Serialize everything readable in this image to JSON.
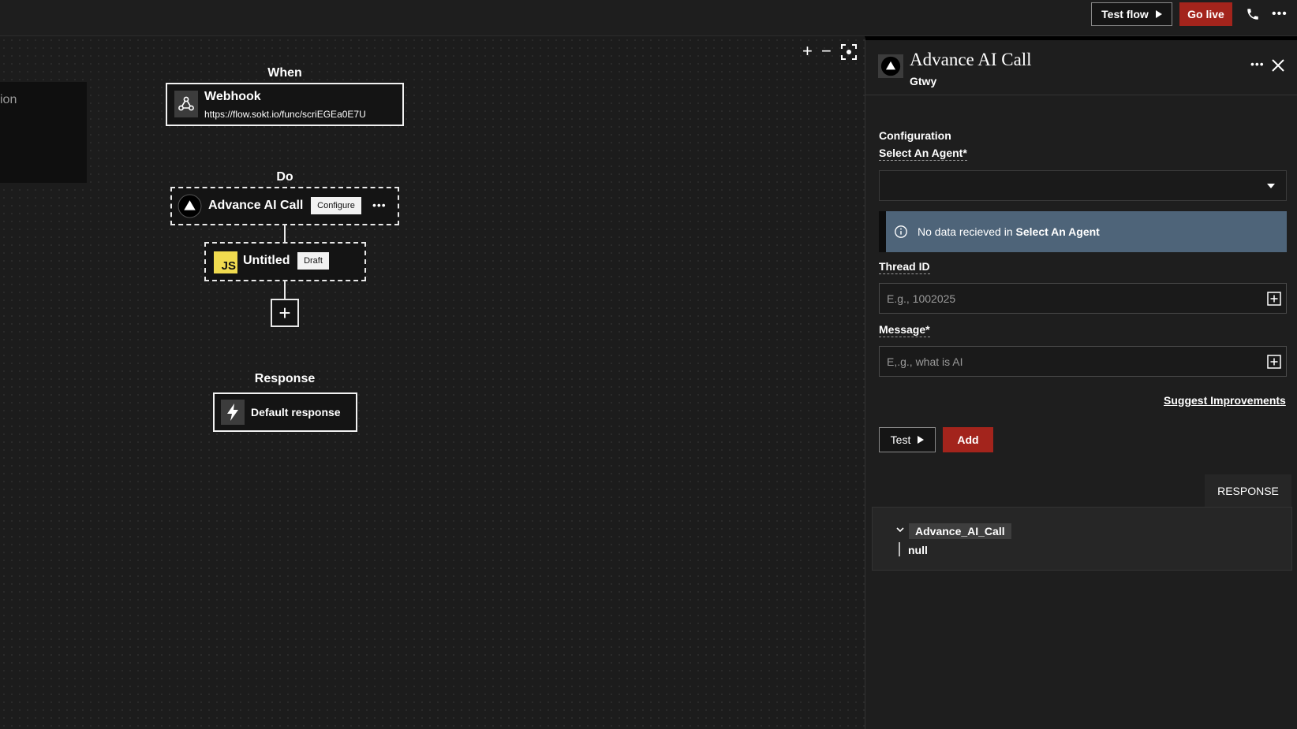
{
  "topbar": {
    "test_flow_label": "Test flow",
    "go_live_label": "Go live",
    "phone_icon": "phone-icon",
    "more_icon": "more-horizontal-icon",
    "more_glyph": "•••"
  },
  "canvas": {
    "left_partial_text": "ion",
    "zoom_in": "+",
    "zoom_out": "−",
    "fit_icon": "fit-screen-icon",
    "when_label": "When",
    "webhook": {
      "title": "Webhook",
      "url": "https://flow.sokt.io/func/scriEGEa0E7U",
      "icon": "webhook-icon"
    },
    "do_label": "Do",
    "ai_node": {
      "title": "Advance AI Call",
      "configure_label": "Configure",
      "more_glyph": "•••",
      "icon": "triangle-logo-icon"
    },
    "js_node": {
      "icon_text": "JS",
      "title": "Untitled",
      "badge": "Draft"
    },
    "add_step_glyph": "+",
    "response_label": "Response",
    "default_response": {
      "title": "Default response",
      "icon": "lightning-icon"
    }
  },
  "panel": {
    "title": "Advance AI Call",
    "subtitle": "Gtwy",
    "more_glyph": "•••",
    "close_icon": "close-icon",
    "configuration_heading": "Configuration",
    "select_agent_label": "Select An Agent*",
    "select_agent_value": "",
    "notice_prefix": "No data recieved in ",
    "notice_bold": "Select An Agent",
    "thread_label": "Thread ID",
    "thread_placeholder": "E.g., 1002025",
    "message_label": "Message*",
    "message_placeholder": "E,.g., what is AI",
    "suggest_label": "Suggest Improvements",
    "test_label": "Test",
    "add_label": "Add",
    "response_tab": "RESPONSE",
    "response_key": "Advance_AI_Call",
    "response_value": "null"
  },
  "colors": {
    "accent_red": "#a3241c",
    "notice_blue": "#4e6479",
    "js_yellow": "#f0db4f",
    "background": "#1b1b1b"
  }
}
